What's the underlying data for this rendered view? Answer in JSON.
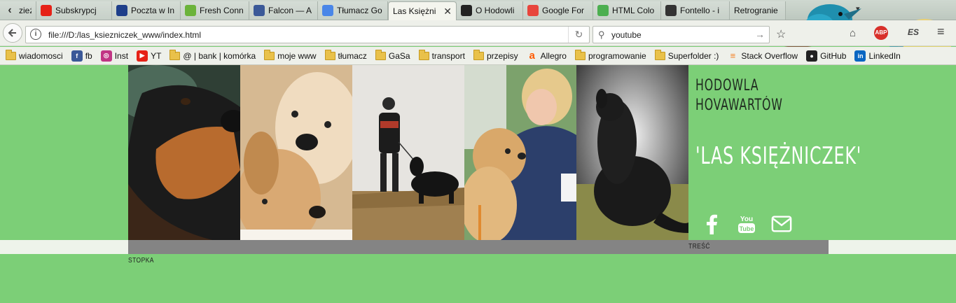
{
  "browser": {
    "tabs": [
      {
        "title": "zieżnic",
        "favicon": "back-arrow",
        "active": false,
        "color": "#555555"
      },
      {
        "title": "Subskrypcj",
        "favicon": "youtube-icon",
        "active": false,
        "color": "#e62117"
      },
      {
        "title": "Poczta w In",
        "favicon": "interia-icon",
        "active": false,
        "color": "#1e3f8a"
      },
      {
        "title": "Fresh Conn",
        "favicon": "leaf-icon",
        "active": false,
        "color": "#6bb33a"
      },
      {
        "title": "Falcon — A",
        "favicon": "facebook-icon",
        "active": false,
        "color": "#3b5998"
      },
      {
        "title": "Tłumacz Go",
        "favicon": "translate-icon",
        "active": false,
        "color": "#4a86e8"
      },
      {
        "title": "Las Księżnic",
        "favicon": "",
        "active": true,
        "color": "#ffffff"
      },
      {
        "title": "O Hodowli",
        "favicon": "paw-icon",
        "active": false,
        "color": "#222222"
      },
      {
        "title": "Google For",
        "favicon": "forms-icon",
        "active": false,
        "color": "#e8453c"
      },
      {
        "title": "HTML Colo",
        "favicon": "htmlcolor-icon",
        "active": false,
        "color": "#4caf50"
      },
      {
        "title": "Fontello - i",
        "favicon": "scissors-icon",
        "active": false,
        "color": "#333333"
      },
      {
        "title": "Retrogranie",
        "favicon": "",
        "active": false,
        "color": "#999999"
      }
    ],
    "url": "file:///D:/las_ksiezniczek_www/index.html",
    "search_query": "youtube",
    "bookmarks": [
      {
        "label": "wiadomosci",
        "icon": "folder-icon"
      },
      {
        "label": "fb",
        "icon": "facebook-icon"
      },
      {
        "label": "Inst",
        "icon": "instagram-icon"
      },
      {
        "label": "YT",
        "icon": "youtube-icon"
      },
      {
        "label": "@ | bank | komórka",
        "icon": "folder-icon"
      },
      {
        "label": "moje www",
        "icon": "folder-icon"
      },
      {
        "label": "tłumacz",
        "icon": "folder-icon"
      },
      {
        "label": "GaSa",
        "icon": "folder-icon"
      },
      {
        "label": "transport",
        "icon": "folder-icon"
      },
      {
        "label": "przepisy",
        "icon": "folder-icon"
      },
      {
        "label": "Allegro",
        "icon": "allegro-icon"
      },
      {
        "label": "programowanie",
        "icon": "folder-icon"
      },
      {
        "label": "Superfolder :)",
        "icon": "folder-icon"
      },
      {
        "label": "Stack Overflow",
        "icon": "stackoverflow-icon"
      },
      {
        "label": "GitHub",
        "icon": "github-icon"
      },
      {
        "label": "LinkedIn",
        "icon": "linkedin-icon"
      }
    ],
    "abp_badge": "ABP",
    "es_badge": "ES"
  },
  "page": {
    "brand_line1": "HODOWLA",
    "brand_line2": "HOVAWARTÓW",
    "brand_name": "'LAS KSIĘŻNICZEK'",
    "content_label": "TREŚĆ",
    "footer_label": "STOPKA",
    "social": [
      "facebook-icon",
      "youtube-icon",
      "envelope-icon"
    ],
    "colors": {
      "background": "#7ccf77",
      "content_bar": "#848484",
      "content_band": "#eef3ea"
    }
  }
}
